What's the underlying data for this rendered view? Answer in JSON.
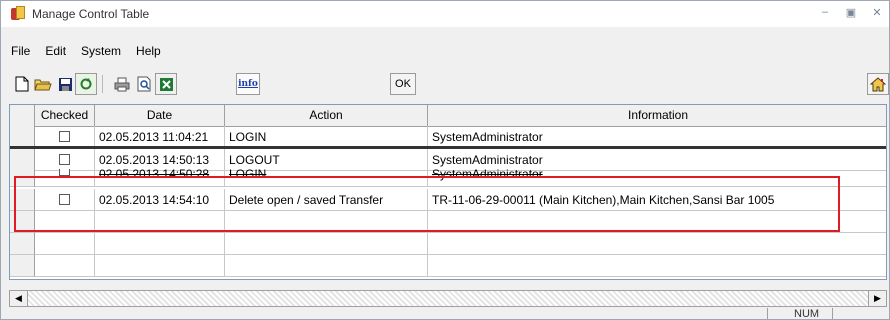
{
  "window": {
    "title": "Manage Control Table",
    "minimize_icon": "minimize-icon",
    "maximize_icon": "maximize-icon",
    "close_icon": "close-icon"
  },
  "menu": {
    "items": [
      "File",
      "Edit",
      "System",
      "Help"
    ]
  },
  "toolbar": {
    "ok_label": "OK",
    "info_label": "info"
  },
  "table": {
    "columns": [
      "Checked",
      "Date",
      "Action",
      "Information"
    ],
    "rows": [
      {
        "checked": false,
        "date": "02.05.2013 11:04:21",
        "action": "LOGIN",
        "information": "SystemAdministrator"
      },
      {
        "checked": false,
        "date": "02.05.2013 14:50:13",
        "action": "LOGOUT",
        "information": "SystemAdministrator"
      },
      {
        "checked": false,
        "date": "02.05.2013 14:50:28",
        "action": "LOGIN",
        "information": "SystemAdministrator"
      },
      {
        "checked": false,
        "date": "02.05.2013 14:54:10",
        "action": "Delete open / saved Transfer",
        "information": "TR-11-06-29-00011  (Main Kitchen),Main Kitchen,Sansi Bar 1005"
      }
    ]
  },
  "statusbar": {
    "num": "NUM"
  }
}
